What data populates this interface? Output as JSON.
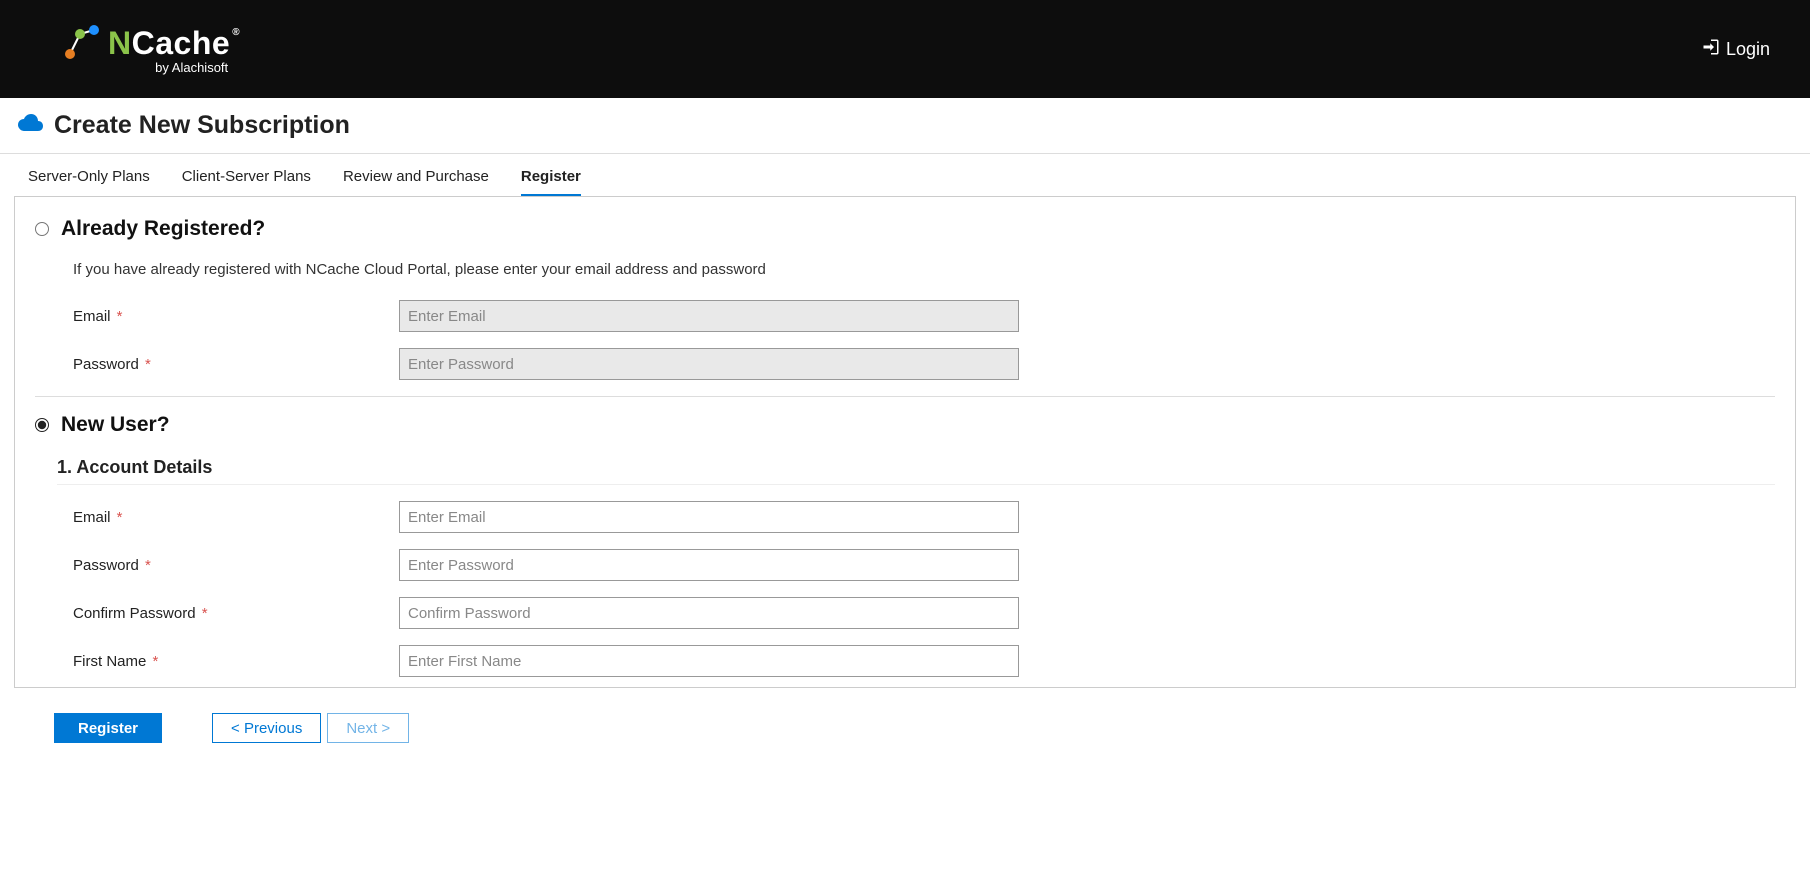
{
  "header": {
    "logo_main": "NCache",
    "logo_sub": "by Alachisoft",
    "login_label": "Login"
  },
  "page": {
    "title": "Create New Subscription"
  },
  "tabs": {
    "items": [
      "Server-Only Plans",
      "Client-Server Plans",
      "Review and Purchase",
      "Register"
    ],
    "active_index": 3
  },
  "already": {
    "heading": "Already Registered?",
    "desc": "If you have already registered with NCache Cloud Portal, please enter your email address and password",
    "email_label": "Email",
    "email_placeholder": "Enter Email",
    "password_label": "Password",
    "password_placeholder": "Enter Password"
  },
  "newuser": {
    "heading": "New User?",
    "section1_heading": "1. Account Details",
    "email_label": "Email",
    "email_placeholder": "Enter Email",
    "password_label": "Password",
    "password_placeholder": "Enter Password",
    "confirm_label": "Confirm Password",
    "confirm_placeholder": "Confirm Password",
    "first_name_label": "First Name",
    "first_name_placeholder": "Enter First Name"
  },
  "footer": {
    "register_label": "Register",
    "previous_label": "< Previous",
    "next_label": "Next >"
  }
}
